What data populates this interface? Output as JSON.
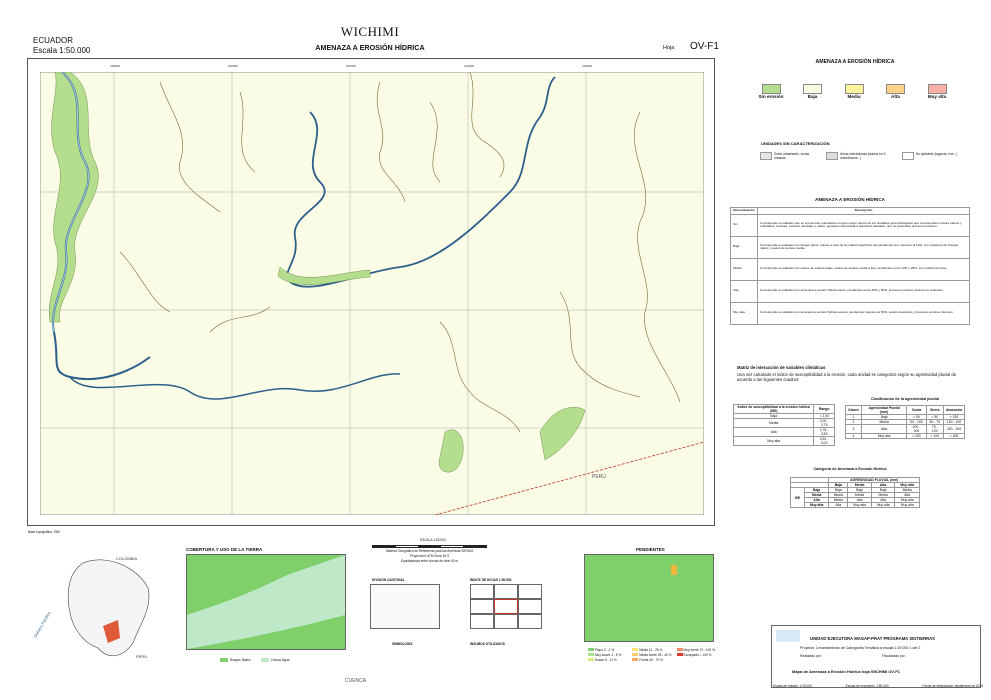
{
  "header": {
    "country": "ECUADOR",
    "scale": "Escala 1:50.000",
    "map_name": "WICHIMI",
    "theme": "AMENAZA A EROSIÓN HÍDRICA",
    "hoja_label": "Hoja",
    "sheet_code": "OV-F1"
  },
  "map": {
    "country_label": "PERÚ",
    "top_ticks": [
      "228000",
      "230000",
      "232000",
      "234000",
      "236000",
      "238000"
    ],
    "left_ticks": [
      "9722000",
      "9720000",
      "9718000",
      "9716000"
    ],
    "colors": {
      "background": "#fbfce6",
      "erosion_none": "#b5dd8e",
      "river": "#a9cfe8",
      "river_line": "#2c5f8a",
      "stream": "#7a6a35",
      "border": "#c0392b"
    }
  },
  "legend": {
    "title": "AMENAZA A EROSIÓN HÍDRICA",
    "classes": [
      {
        "label": "Sin erosión",
        "color": "#b5dd8e"
      },
      {
        "label": "Baja",
        "color": "#fbfce6"
      },
      {
        "label": "Media",
        "color": "#fff59a"
      },
      {
        "label": "Alta",
        "color": "#ffd08a"
      },
      {
        "label": "Muy alta",
        "color": "#f7b0a8"
      }
    ],
    "units_title": "UNIDADES SIN CARACTERIZACIÓN",
    "units": [
      {
        "label": "Suelo urbanizado, zonas urbanas"
      },
      {
        "label": "Áreas misceláneas (suelos en S. montañosos...)"
      },
      {
        "label": "No aplicable (lagunas, ríos...)"
      }
    ]
  },
  "desc_table": {
    "title": "AMENAZA A EROSIÓN HÍDRICA",
    "col1": "Denominación",
    "col2": "Descripción",
    "rows": [
      {
        "name": "Sin",
        "text": "Corresponde a unidades que se encuentran colocalizan su gran mayor dentro de los unidades geomorfológicas que corresponden niveles planos y ondulados, terrazas, coluvios, aluviales y valles, geología relacionada a depósitos aluviales, que no presentan procesos erosivos."
      },
      {
        "name": "Baja",
        "text": "Corresponde a unidades con bloque plano: relieve a nivel de la unidad superficial, las pendientes son menores al 12%, con cobertura de bosque nativo y suelos de textura media."
      },
      {
        "name": "Media",
        "text": "Corresponde a unidades con relieve de colinas bajas; suelos de textura media a fina, pendientes entre 12% y 25%, con cobertura mixta."
      },
      {
        "name": "Alta",
        "text": "Corresponde a unidades con amenaza a erosión hídrica fuerte, pendientes entre 25% y 50%, procesos erosivos activos en vertientes."
      },
      {
        "name": "Muy alta",
        "text": "Corresponde a unidades con amenaza a erosión hídrica severa; pendientes mayores al 50%, suelos desnudos y procesos erosivos intensos."
      }
    ]
  },
  "matrix": {
    "title": "Matriz de interacción de variables climáticas",
    "intro": "Una vez calculado el índice de susceptibilidad a la erosión, cada unidad se categoriza según su agresividad pluvial de acuerdo a las siguientes cuadros:",
    "suscept_headers": [
      "Índice de susceptibilidad a la erosión hídrica (ISE)",
      "Rango"
    ],
    "suscept_rows": [
      [
        "Baja",
        "< 2,00"
      ],
      [
        "Media",
        "2,01 - 2,75"
      ],
      [
        "Alta",
        "2,76 - 3,50"
      ],
      [
        "Muy alta",
        "3,51 - 4,00"
      ]
    ],
    "pluvial_title": "Clasificación de la agresividad pluvial",
    "pluvial_headers": [
      "Clases",
      "Agresividad Pluvial (mm)",
      "Costa",
      "Sierra",
      "Amazonía"
    ],
    "pluvial_rows": [
      [
        "1",
        "Baja",
        "< 50",
        "< 50",
        "< 150"
      ],
      [
        "2",
        "Media",
        "50 - 100",
        "50 - 75",
        "150 - 200"
      ],
      [
        "3",
        "Alta",
        "100 - 200",
        "75 - 100",
        "200 - 300"
      ],
      [
        "4",
        "Muy alta",
        "> 200",
        "> 100",
        "> 300"
      ]
    ],
    "cat_title": "Categoría de Amenaza a Erosión Hídrica",
    "cat_header": "AGRESIVIDAD PLUVIAL (mm)",
    "cat_cols": [
      "Baja",
      "Media",
      "Alta",
      "Muy alta"
    ],
    "cat_side": "ISE",
    "cat_rows": [
      {
        "label": "Baja",
        "vals": [
          "Baja",
          "Baja",
          "Baja",
          "Media"
        ]
      },
      {
        "label": "Media",
        "vals": [
          "Media",
          "Media",
          "Media",
          "Alta"
        ]
      },
      {
        "label": "Alta",
        "vals": [
          "Media",
          "Alta",
          "Alta",
          "Muy alta"
        ]
      },
      {
        "label": "Muy alta",
        "vals": [
          "Alta",
          "Muy alta",
          "Muy alta",
          "Muy alta"
        ]
      }
    ]
  },
  "bottom": {
    "notes": "Base topográfica: IGM",
    "cobertura_title": "COBERTURA Y USO DE LA TIERRA",
    "cobertura_legend": [
      "Bosque Nativo",
      "Cuerpo Agua"
    ],
    "scale_label": "ESCALA 1:50.000",
    "scale_ticks": [
      "0",
      "1",
      "2",
      "3",
      "4",
      "5"
    ],
    "sistema": "Sistema Geográfico de Referencia para las Américas SIRGAS",
    "proyeccion": "Proyección UTM Zona 18 S",
    "equidistancia": "Equidistancia entre curvas de nivel 40 m",
    "division": "DIVISIÓN CANTONAL",
    "indice": "ÍNDICE DE HOJAS 1:50.000",
    "simbologia": "SIMBOLOGÍA",
    "insumos": "INSUMOS UTILIZADOS",
    "pendientes_title": "PENDIENTES",
    "pendientes_legend": [
      "Plano 0 - 2 %",
      "Muy suave 2 - 5 %",
      "Suave 5 - 12 %",
      "Media 12 - 25 %",
      "Media fuerte 25 - 40 %",
      "Fuerte 40 - 70 %",
      "Muy fuerte 70 - 100 %",
      "Escarpado > 100 %"
    ],
    "country_neighbors": [
      "COLOMBIA",
      "PERÚ",
      "Océano Pacífico"
    ],
    "cuenca": "CUENCA"
  },
  "titleblock": {
    "unit": "UNIDAD EJECUTORA MAGAP-PRAT PROGRAMA SIGTIERRAS",
    "project": "Proyecto:  Levantamiento de Cartografía Temática a escala 1:25.000, Lote 2",
    "realizado": "Realizado por:",
    "fiscalizado": "Fiscalizado por:",
    "map_title": "Mapa de Amenaza a Erosión Hídrica hoja WICHIMI OV-F1",
    "footer": [
      "Escala de trabajo: 1:25.000",
      "Escala de impresión: 1:50.000",
      "Fecha de elaboración: septiembre de 2015"
    ]
  }
}
